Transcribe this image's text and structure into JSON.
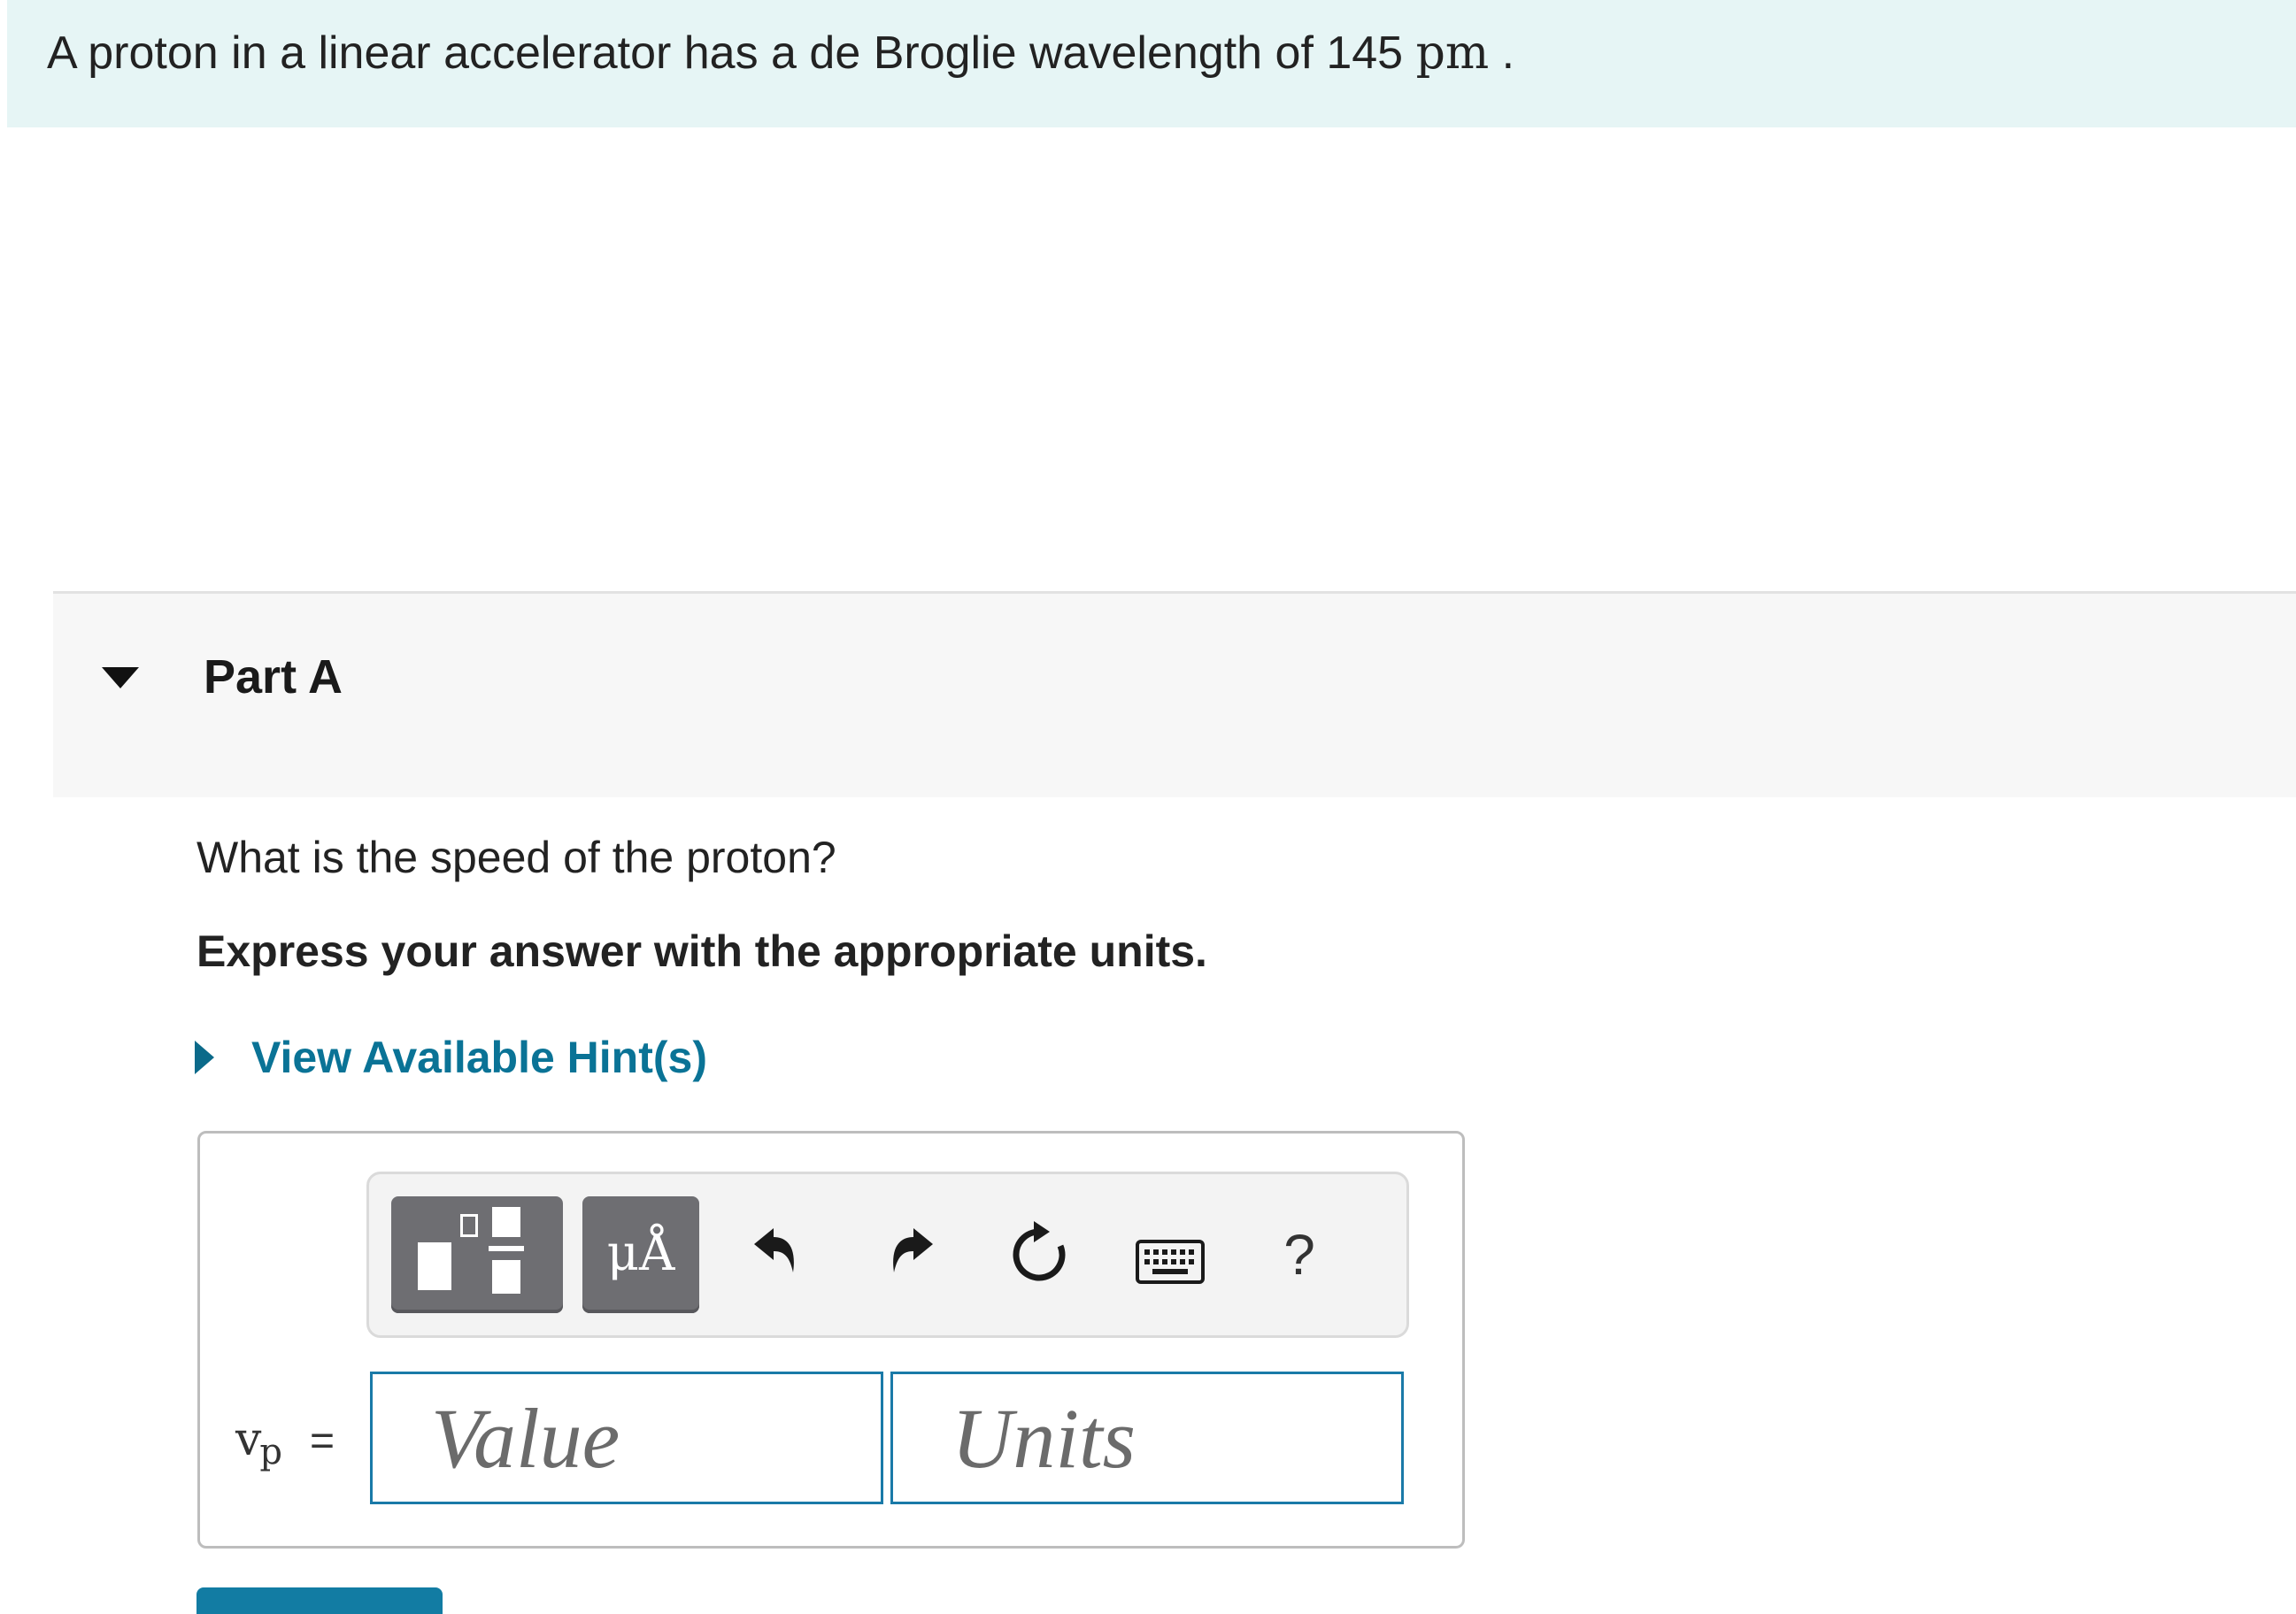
{
  "problem": {
    "text": "A proton in a linear accelerator has a de Broglie wavelength of 145",
    "unit": "pm",
    "period": "."
  },
  "part": {
    "title": "Part A"
  },
  "question": {
    "prompt": "What is the speed of the proton?",
    "instruction": "Express your answer with the appropriate units."
  },
  "hint": {
    "label": "View Available Hint(s)"
  },
  "toolbar": {
    "units_glyph": "μÅ",
    "help_label": "?",
    "icons": [
      "templates-icon",
      "units-icon",
      "undo-icon",
      "redo-icon",
      "reset-icon",
      "keyboard-icon",
      "help-icon"
    ]
  },
  "answer": {
    "variable": "v",
    "subscript": "p",
    "equals": "=",
    "value_placeholder": "Value",
    "units_placeholder": "Units"
  },
  "colors": {
    "banner_bg": "#e6f5f5",
    "accent": "#0a7396",
    "input_border": "#1a7aa8",
    "tool_button": "#6e6e72"
  }
}
